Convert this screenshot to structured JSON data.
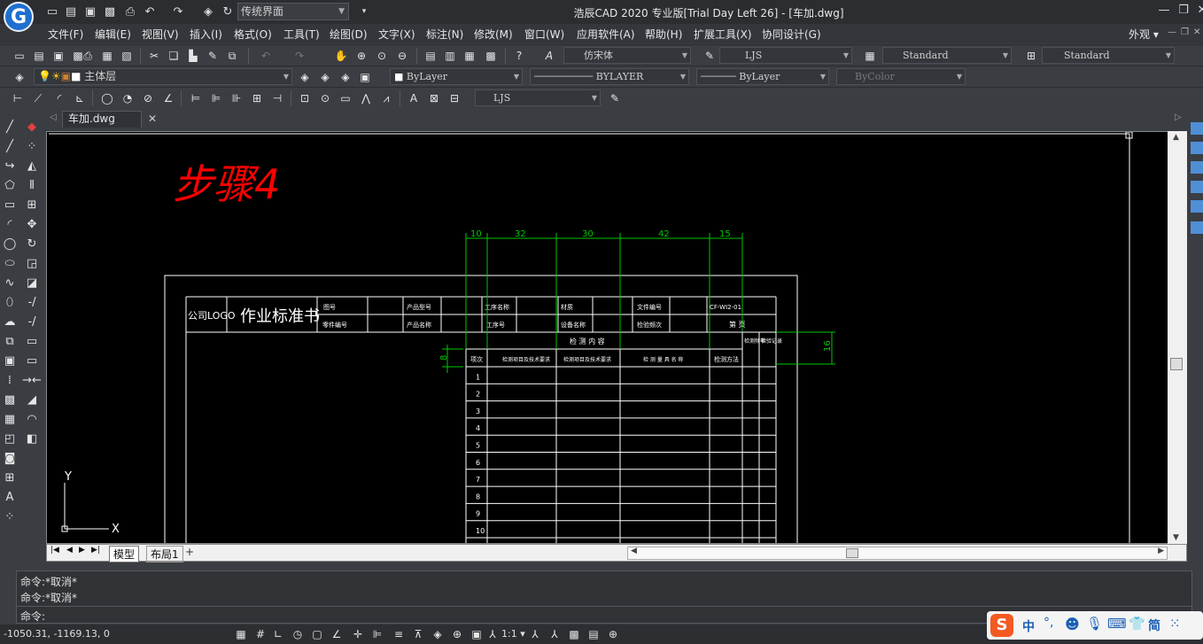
{
  "titlebar": {
    "workspace": "传统界面",
    "title": "浩辰CAD 2020 专业版[Trial Day Left 26] - [车加.dwg]"
  },
  "menu": {
    "items": [
      "文件(F)",
      "编辑(E)",
      "视图(V)",
      "插入(I)",
      "格式(O)",
      "工具(T)",
      "绘图(D)",
      "文字(X)",
      "标注(N)",
      "修改(M)",
      "窗口(W)",
      "应用软件(A)",
      "帮助(H)",
      "扩展工具(X)",
      "协同设计(G)"
    ],
    "appearance": "外观"
  },
  "toolbar": {
    "font_combo": "仿宋体",
    "dimstyle_combo": "LJS",
    "textstyle_combo": "Standard",
    "tablestyle_combo": "Standard",
    "layer_combo": "主体层",
    "color_combo": "ByLayer",
    "linetype_combo": "BYLAYER",
    "lineweight_combo": "ByLayer",
    "plotstyle_combo": "ByColor",
    "dim_combo2": "LJS"
  },
  "document": {
    "tab": "车加.dwg"
  },
  "drawing": {
    "step_text": "步骤4",
    "dims_top": [
      "10",
      "32",
      "30",
      "42",
      "15"
    ],
    "dim_right": "16",
    "dim_left": "8",
    "company_logo": "公司LOGO",
    "doc_title": "作业标准书",
    "header_row1": [
      "图号",
      "产品型号",
      "工序名称",
      "材质",
      "文件编号",
      "CF-WI2-01"
    ],
    "header_row2": [
      "零件编号",
      "产品名称",
      "工序号",
      "设备名称",
      "检验频次",
      "第  页"
    ],
    "table_group": "检  测  内  容",
    "col_headers": [
      "项次",
      "检测项目及技术要求",
      "检测项目及技术要求",
      "检  测  量  具  名  称",
      "检测方法",
      "检测频率",
      "检验记录"
    ],
    "row_numbers": [
      "1",
      "2",
      "3",
      "4",
      "5",
      "6",
      "7",
      "8",
      "9",
      "10"
    ],
    "ucs_y": "Y",
    "ucs_x": "X"
  },
  "layout_tabs": {
    "model": "模型",
    "layout1": "布局1",
    "add": "+"
  },
  "command": {
    "lines": [
      "命令:*取消*",
      "命令:*取消*"
    ],
    "prompt": "命令:"
  },
  "status": {
    "coords": "-1050.31, -1169.13, 0",
    "scale": "1:1"
  },
  "ime": {
    "lang": "中",
    "mode": "简"
  },
  "colors": {
    "step_text": "#ff0000",
    "dimension": "#00c800",
    "table_lines": "#ffffff",
    "canvas_bg": "#000000"
  }
}
